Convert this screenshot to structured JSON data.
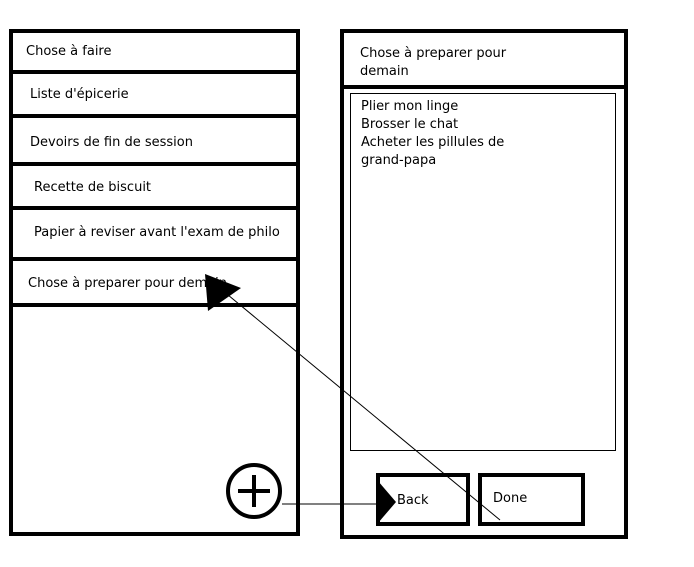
{
  "left_panel": {
    "header_title": "Chose à faire",
    "items": [
      {
        "label": "Liste d'épicerie"
      },
      {
        "label": "Devoirs de fin de session"
      },
      {
        "label": "Recette de biscuit"
      },
      {
        "label": "Papier à reviser avant l'exam de philo"
      },
      {
        "label": "Chose à preparer pour demain"
      }
    ],
    "add_button_icon": "plus-circle-icon"
  },
  "right_panel": {
    "header_title": "Chose à preparer pour demain",
    "details_lines": [
      "Plier mon linge",
      "Brosser le chat",
      "Acheter les pillules de",
      "grand-papa"
    ],
    "back_label": "Back",
    "done_label": "Done"
  },
  "annotations": {
    "arrow_icons": [
      "arrow-to-item-icon",
      "arrow-to-back-icon"
    ]
  }
}
